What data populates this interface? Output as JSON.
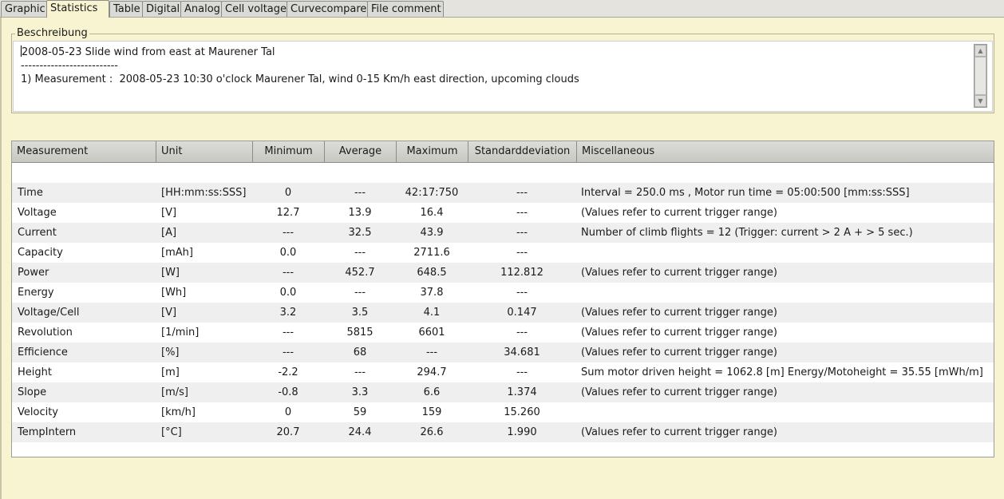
{
  "tabs": [
    "Graphic",
    "Statistics",
    "Table",
    "Digital",
    "Analog",
    "Cell voltage",
    "Curvecompare",
    "File comment"
  ],
  "active_tab": "Statistics",
  "description": {
    "legend": "Beschreibung",
    "lines": [
      "2008-05-23 Slide wind from east at Maurener Tal",
      "--------------------------",
      "1) Measurement :  2008-05-23 10:30 o'clock Maurener Tal, wind 0-15 Km/h east direction, upcoming clouds"
    ]
  },
  "table": {
    "headers": [
      "Measurement",
      "Unit",
      "Minimum",
      "Average",
      "Maximum",
      "Standarddeviation",
      "Miscellaneous"
    ],
    "rows": [
      {
        "measurement": "Time",
        "unit": "[HH:mm:ss:SSS]",
        "min": "0",
        "avg": "---",
        "max": "42:17:750",
        "std": "---",
        "misc": "Interval =  250.0 ms , Motor run time = 05:00:500 [mm:ss:SSS]"
      },
      {
        "measurement": "Voltage",
        "unit": "[V]",
        "min": "12.7",
        "avg": "13.9",
        "max": "16.4",
        "std": "---",
        "misc": "(Values refer to current trigger range)"
      },
      {
        "measurement": "Current",
        "unit": "[A]",
        "min": "---",
        "avg": "32.5",
        "max": "43.9",
        "std": "---",
        "misc": "Number of climb flights = 12 (Trigger: current > 2 A + > 5 sec.)"
      },
      {
        "measurement": "Capacity",
        "unit": "[mAh]",
        "min": "0.0",
        "avg": "---",
        "max": "2711.6",
        "std": "---",
        "misc": ""
      },
      {
        "measurement": "Power",
        "unit": "[W]",
        "min": "---",
        "avg": "452.7",
        "max": "648.5",
        "std": "112.812",
        "misc": "(Values refer to current trigger range)"
      },
      {
        "measurement": "Energy",
        "unit": "[Wh]",
        "min": "0.0",
        "avg": "---",
        "max": "37.8",
        "std": "---",
        "misc": ""
      },
      {
        "measurement": "Voltage/Cell",
        "unit": "[V]",
        "min": "3.2",
        "avg": "3.5",
        "max": "4.1",
        "std": "0.147",
        "misc": "(Values refer to current trigger range)"
      },
      {
        "measurement": "Revolution",
        "unit": "[1/min]",
        "min": "---",
        "avg": "5815",
        "max": "6601",
        "std": "---",
        "misc": "(Values refer to current trigger range)"
      },
      {
        "measurement": "Efficience",
        "unit": "[%]",
        "min": "---",
        "avg": "68",
        "max": "---",
        "std": "34.681",
        "misc": "(Values refer to current trigger range)"
      },
      {
        "measurement": "Height",
        "unit": "[m]",
        "min": "-2.2",
        "avg": "---",
        "max": "294.7",
        "std": "---",
        "misc": "Sum motor driven height = 1062.8 [m]   Energy/Motoheight = 35.55 [mWh/m]"
      },
      {
        "measurement": "Slope",
        "unit": "[m/s]",
        "min": "-0.8",
        "avg": "3.3",
        "max": "6.6",
        "std": "1.374",
        "misc": "(Values refer to current trigger range)"
      },
      {
        "measurement": "Velocity",
        "unit": "[km/h]",
        "min": "0",
        "avg": "59",
        "max": "159",
        "std": "15.260",
        "misc": ""
      },
      {
        "measurement": "TempIntern",
        "unit": "[°C]",
        "min": "20.7",
        "avg": "24.4",
        "max": "26.6",
        "std": "1.990",
        "misc": "(Values refer to current trigger range)"
      }
    ]
  }
}
